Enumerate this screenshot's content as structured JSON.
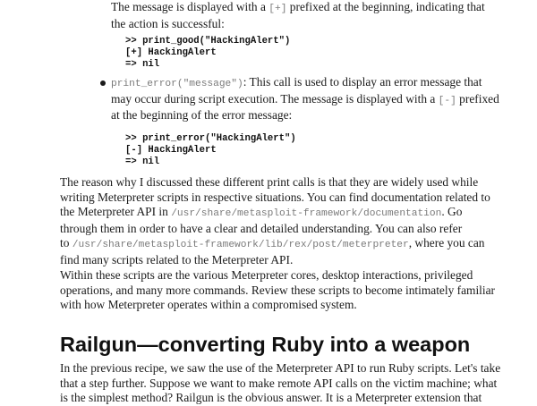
{
  "good_para": {
    "line1_text": "The message is displayed with a ",
    "line1_code": "[+]",
    "line1_after": " prefixed at the beginning, indicating that",
    "line2": "the action is successful:"
  },
  "code_good": [
    ">> print_good(\"HackingAlert\")",
    "[+] HackingAlert",
    "=> nil"
  ],
  "error_bullet": {
    "code": "print_error(\"message\")",
    "line1_after": ": This call is used to display an error message that",
    "line2_before": "may occur during script execution. The message is displayed with a ",
    "line2_code": "[-]",
    "line2_after": " prefixed",
    "line3": "at the beginning of the error message:"
  },
  "code_error": [
    ">> print_error(\"HackingAlert\")",
    "[-] HackingAlert",
    "=> nil"
  ],
  "reason_para": {
    "l1": "The reason why I discussed these different print calls is that they are widely used while",
    "l2": "writing Meterpreter scripts in respective situations. You can find documentation related to",
    "l3_before": "the Meterpreter API in ",
    "l3_code": "/usr/share/metasploit-framework/documentation",
    "l3_after": ". Go",
    "l4": "through them in order to have a clear and detailed understanding. You can also refer",
    "l5_before": "to ",
    "l5_code": "/usr/share/metasploit-framework/lib/rex/post/meterpreter",
    "l5_after": ", where you can",
    "l6": "find many scripts related to the Meterpreter API."
  },
  "within_para": {
    "l1": "Within these scripts are the various Meterpreter cores, desktop interactions, privileged",
    "l2": "operations, and many more commands. Review these scripts to become intimately familiar",
    "l3": "with how Meterpreter operates within a compromised system."
  },
  "heading": "Railgun—converting Ruby into a weapon",
  "intro_para": {
    "l1": "In the previous recipe, we saw the use of the Meterpreter API to run Ruby scripts. Let's take",
    "l2": "that a step further. Suppose we want to make remote API calls on the victim machine; what",
    "l3": "is the simplest method? Railgun is the obvious answer. It is a Meterpreter extension that"
  }
}
